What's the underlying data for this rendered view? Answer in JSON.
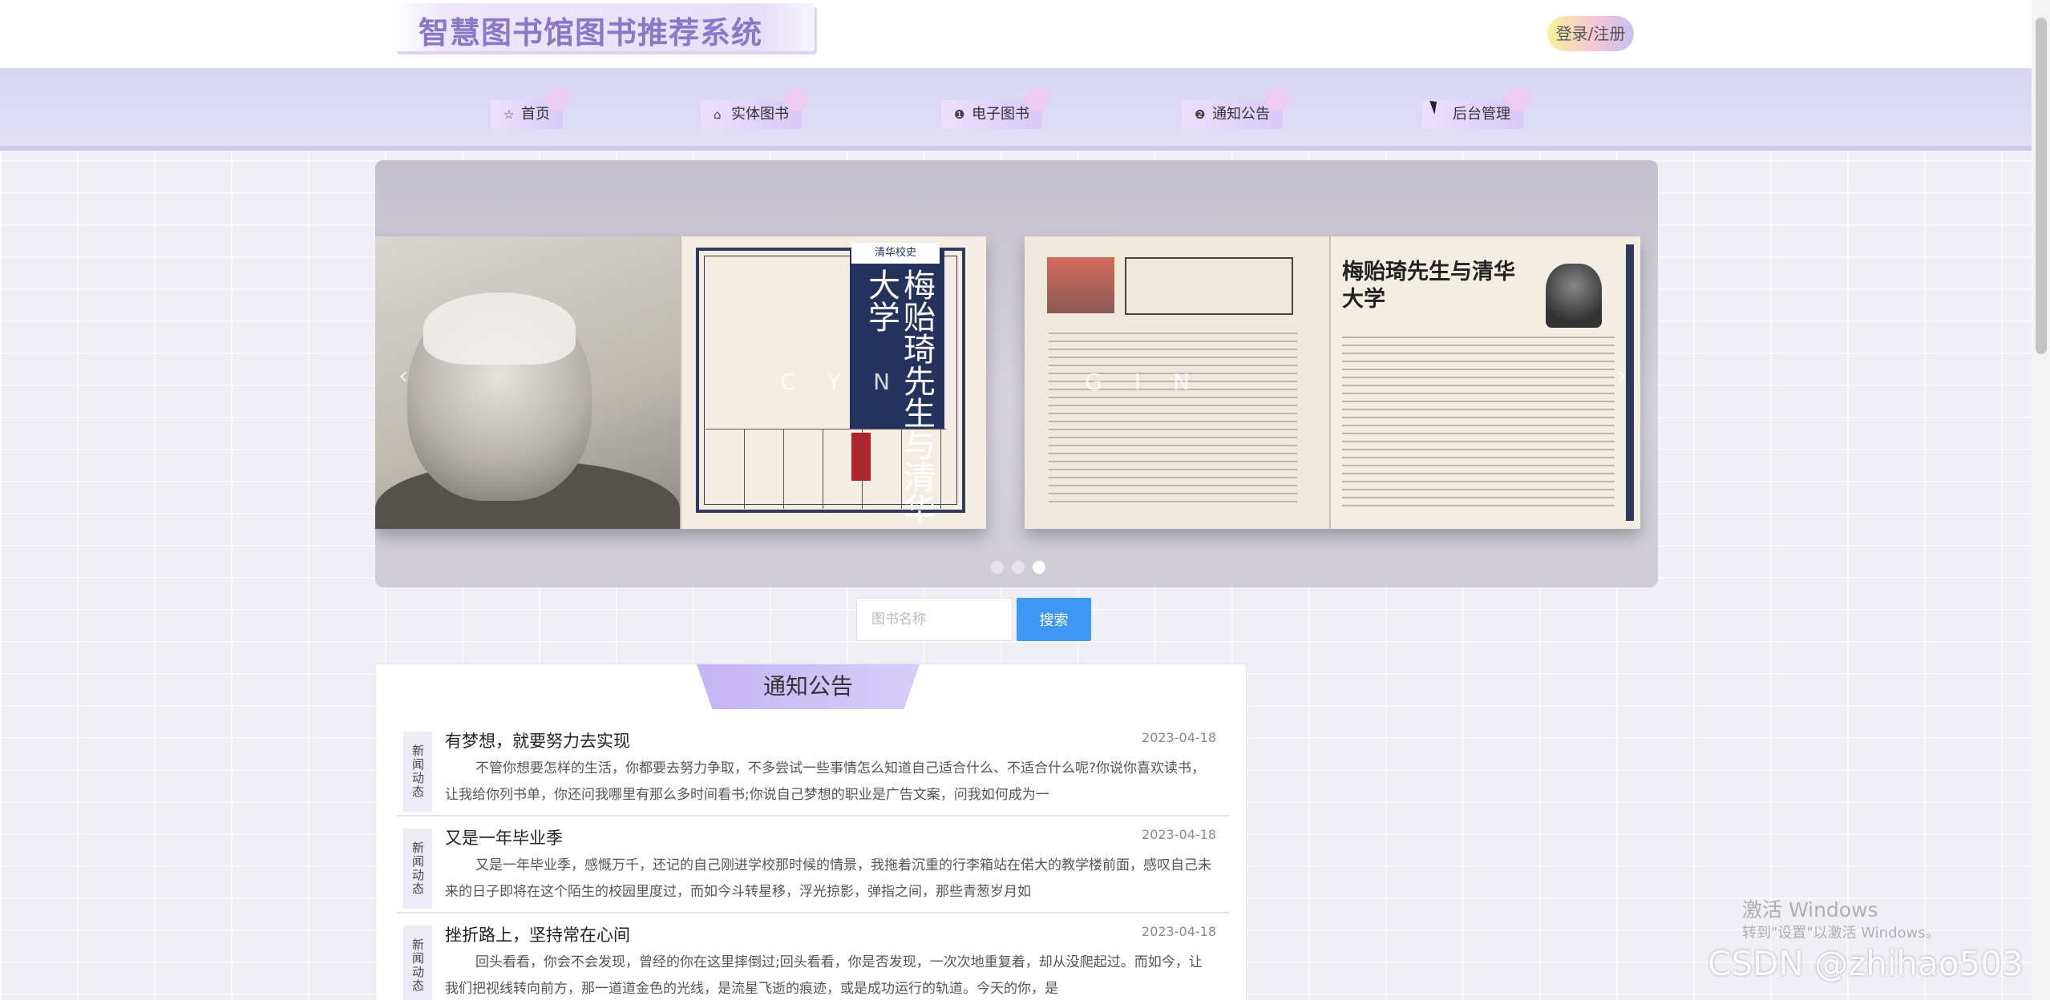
{
  "header": {
    "logo": "智慧图书馆图书推荐系统",
    "login_label": "登录/注册"
  },
  "nav": {
    "items": [
      {
        "icon": "star-icon",
        "glyph": "☆",
        "label": "首页"
      },
      {
        "icon": "home-icon",
        "glyph": "⌂",
        "label": "实体图书"
      },
      {
        "icon": "info-icon",
        "glyph": "❶",
        "label": "电子图书"
      },
      {
        "icon": "help-icon",
        "glyph": "❷",
        "label": "通知公告"
      },
      {
        "icon": "gear-icon",
        "glyph": "",
        "label": "后台管理"
      }
    ]
  },
  "carousel": {
    "slide_text_left": "CYN",
    "slide_text_right": "GIN",
    "book_cover_title": "梅贻琦先生与清华大学",
    "book_article_title": "梅贻琦先生与清华大学",
    "dots": 3,
    "active_dot": 3,
    "arrow_left": "‹",
    "arrow_right": "›"
  },
  "search": {
    "placeholder": "图书名称",
    "button_label": "搜索"
  },
  "notices": {
    "title": "通知公告",
    "items": [
      {
        "tag": "新闻动态",
        "title": "有梦想，就要努力去实现",
        "date": "2023-04-18",
        "content": "不管你想要怎样的生活，你都要去努力争取，不多尝试一些事情怎么知道自己适合什么、不适合什么呢?你说你喜欢读书，让我给你列书单，你还问我哪里有那么多时间看书;你说自己梦想的职业是广告文案，问我如何成为一"
      },
      {
        "tag": "新闻动态",
        "title": "又是一年毕业季",
        "date": "2023-04-18",
        "content": "又是一年毕业季，感慨万千，还记的自己刚进学校那时候的情景，我拖着沉重的行李箱站在偌大的教学楼前面，感叹自己未来的日子即将在这个陌生的校园里度过，而如今斗转星移，浮光掠影，弹指之间，那些青葱岁月如"
      },
      {
        "tag": "新闻动态",
        "title": "挫折路上，坚持常在心间",
        "date": "2023-04-18",
        "content": "回头看看，你会不会发现，曾经的你在这里摔倒过;回头看看，你是否发现，一次次地重复着，却从没爬起过。而如今，让我们把视线转向前方，那一道道金色的光线，是流星飞逝的痕迹，或是成功运行的轨道。今天的你，是"
      }
    ]
  },
  "overlay": {
    "win_activate_1": "激活 Windows",
    "win_activate_2": "转到\"设置\"以激活 Windows。",
    "csdn": "CSDN @zhihao503"
  }
}
